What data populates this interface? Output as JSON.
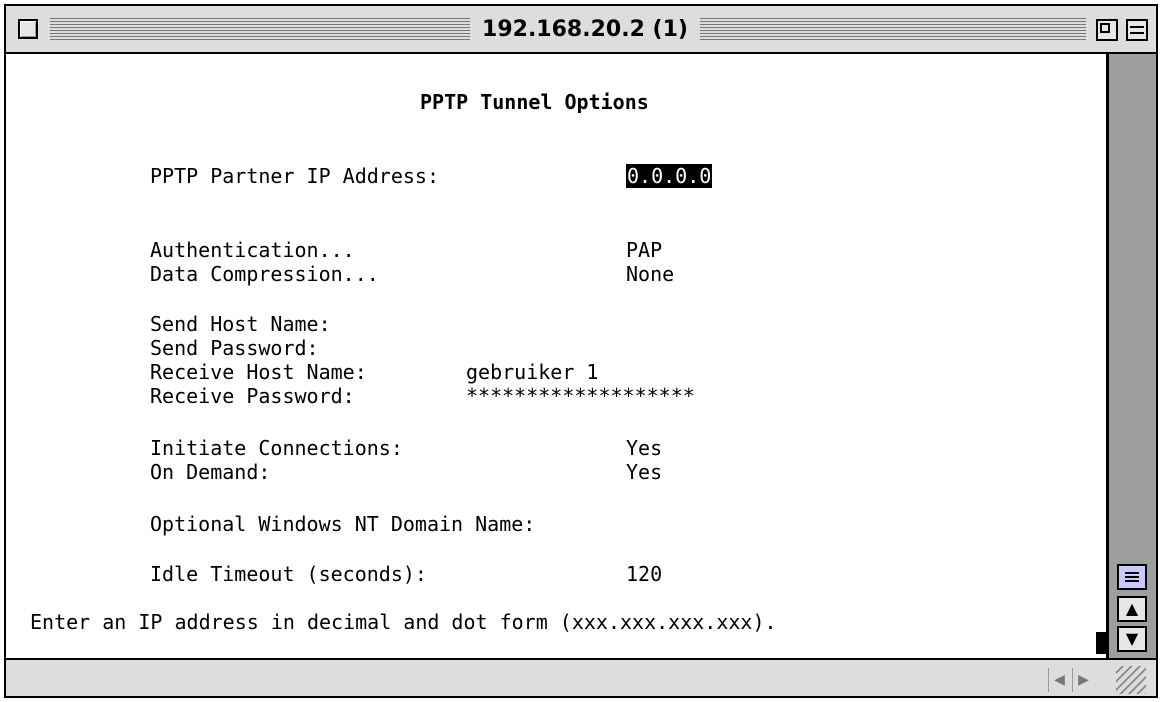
{
  "window": {
    "title": "192.168.20.2 (1)"
  },
  "screen": {
    "heading": "PPTP Tunnel Options",
    "fields": {
      "partner_ip": {
        "label": "PPTP Partner IP Address:",
        "value": "0.0.0.0"
      },
      "authentication": {
        "label": "Authentication...",
        "value": "PAP"
      },
      "data_compression": {
        "label": "Data Compression...",
        "value": "None"
      },
      "send_host_name": {
        "label": "Send Host Name:",
        "value": ""
      },
      "send_password": {
        "label": "Send Password:",
        "value": ""
      },
      "receive_host_name": {
        "label": "Receive Host Name:",
        "value": "gebruiker 1"
      },
      "receive_password": {
        "label": "Receive Password:",
        "value": "*******************"
      },
      "initiate_connections": {
        "label": "Initiate Connections:",
        "value": "Yes"
      },
      "on_demand": {
        "label": "On Demand:",
        "value": "Yes"
      },
      "nt_domain": {
        "label": "Optional Windows NT Domain Name:",
        "value": ""
      },
      "idle_timeout": {
        "label": "Idle Timeout (seconds):",
        "value": "120"
      }
    },
    "status_message": "Enter an IP address in decimal and dot form (xxx.xxx.xxx.xxx)."
  },
  "icons": {
    "up_arrow": "▲",
    "down_arrow": "▼",
    "left_arrow": "◀",
    "right_arrow": "▶"
  }
}
